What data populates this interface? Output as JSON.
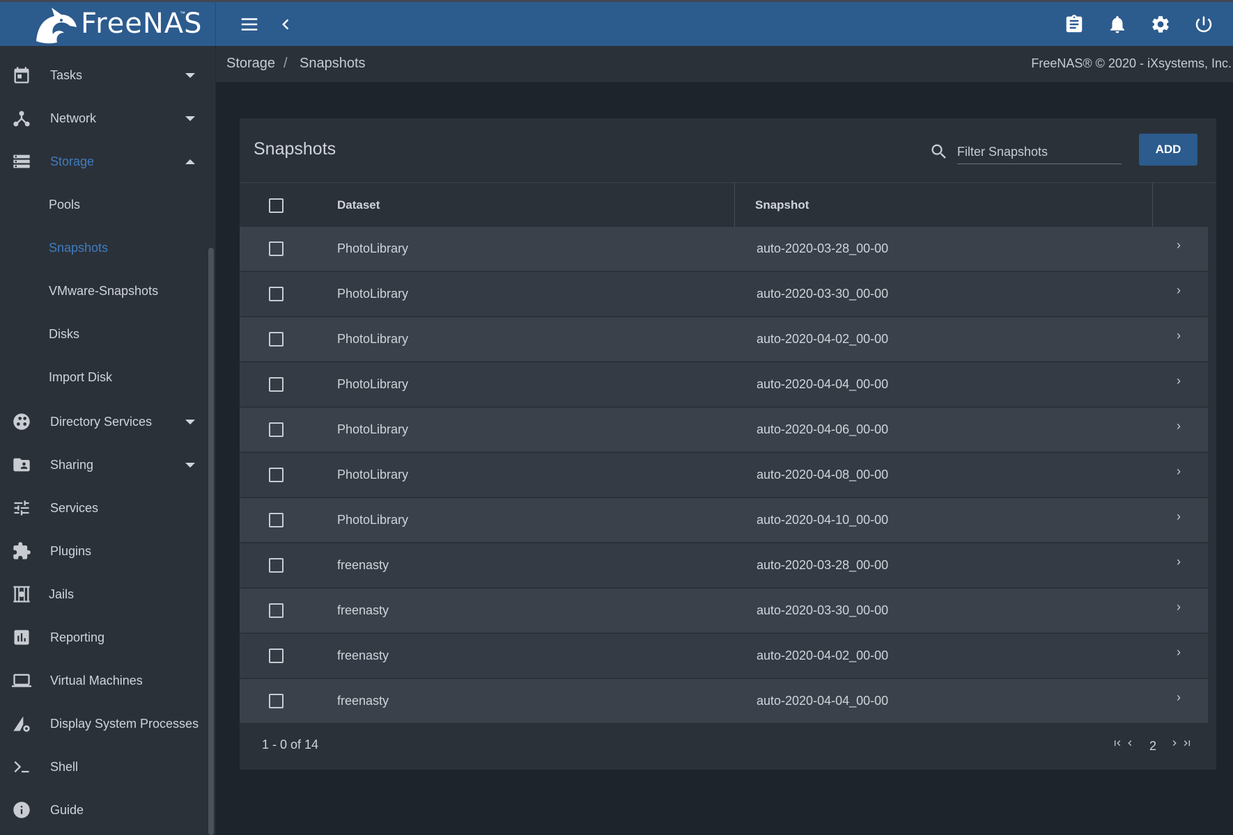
{
  "app": {
    "name": "FreeNAS",
    "tm": "™"
  },
  "topbar": {
    "menu_icon": "hamburger-menu-icon",
    "back_icon": "chevron-left-icon",
    "right_icons": [
      "clipboard-icon",
      "bell-icon",
      "gear-icon",
      "power-icon"
    ]
  },
  "breadcrumb": {
    "parent": "Storage",
    "separator": "/",
    "current": "Snapshots"
  },
  "copyright": "FreeNAS® © 2020 - iXsystems, Inc.",
  "sidebar": {
    "items": [
      {
        "label": "Tasks",
        "icon": "calendar-icon",
        "expand": "down"
      },
      {
        "label": "Network",
        "icon": "network-icon",
        "expand": "down"
      },
      {
        "label": "Storage",
        "icon": "storage-icon",
        "expand": "up",
        "active": true
      },
      {
        "label": "Directory Services",
        "icon": "directory-services-icon",
        "expand": "down"
      },
      {
        "label": "Sharing",
        "icon": "folder-share-icon",
        "expand": "down"
      },
      {
        "label": "Services",
        "icon": "sliders-icon"
      },
      {
        "label": "Plugins",
        "icon": "puzzle-icon"
      },
      {
        "label": "Jails",
        "icon": "jail-icon"
      },
      {
        "label": "Reporting",
        "icon": "bar-chart-icon"
      },
      {
        "label": "Virtual Machines",
        "icon": "laptop-icon"
      },
      {
        "label": "Display System Processes",
        "icon": "system-processes-icon"
      },
      {
        "label": "Shell",
        "icon": "terminal-icon"
      },
      {
        "label": "Guide",
        "icon": "info-icon"
      }
    ],
    "storage_sub": [
      {
        "label": "Pools"
      },
      {
        "label": "Snapshots",
        "active": true
      },
      {
        "label": "VMware-Snapshots"
      },
      {
        "label": "Disks"
      },
      {
        "label": "Import Disk"
      }
    ]
  },
  "card": {
    "title": "Snapshots",
    "search_placeholder": "Filter Snapshots",
    "add_label": "ADD",
    "columns": {
      "dataset": "Dataset",
      "snapshot": "Snapshot"
    },
    "rows": [
      {
        "dataset": "PhotoLibrary",
        "snapshot": "auto-2020-03-28_00-00"
      },
      {
        "dataset": "PhotoLibrary",
        "snapshot": "auto-2020-03-30_00-00"
      },
      {
        "dataset": "PhotoLibrary",
        "snapshot": "auto-2020-04-02_00-00"
      },
      {
        "dataset": "PhotoLibrary",
        "snapshot": "auto-2020-04-04_00-00"
      },
      {
        "dataset": "PhotoLibrary",
        "snapshot": "auto-2020-04-06_00-00"
      },
      {
        "dataset": "PhotoLibrary",
        "snapshot": "auto-2020-04-08_00-00"
      },
      {
        "dataset": "PhotoLibrary",
        "snapshot": "auto-2020-04-10_00-00"
      },
      {
        "dataset": "freenasty",
        "snapshot": "auto-2020-03-28_00-00"
      },
      {
        "dataset": "freenasty",
        "snapshot": "auto-2020-03-30_00-00"
      },
      {
        "dataset": "freenasty",
        "snapshot": "auto-2020-04-02_00-00"
      },
      {
        "dataset": "freenasty",
        "snapshot": "auto-2020-04-04_00-00"
      }
    ],
    "pagination": {
      "range": "1 - 0 of 14",
      "page": "2"
    }
  }
}
